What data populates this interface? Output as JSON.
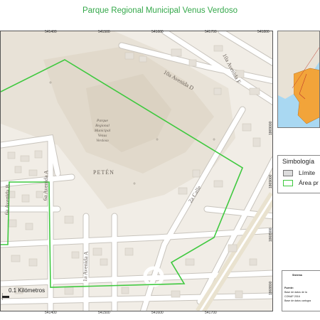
{
  "title": "Parque Regional Municipal Venus Verdoso",
  "map": {
    "labels": {
      "park_name_line1": "Parque",
      "park_name_line2": "Regional",
      "park_name_line3": "Municipal",
      "park_name_line4": "Venus Verdoso",
      "department": "PETÉN"
    },
    "streets": {
      "avenida_f": "10a Avenida F",
      "avenida_d": "10a Avenida D",
      "calle_2a": "2a Calle",
      "avenida_a_top": "6a Avenida A",
      "avenida_a_bottom": "1a Avenida A",
      "avenida_b": "6a Avenida B"
    },
    "ticks_top": [
      "541400",
      "541500",
      "541600",
      "541700",
      "541800"
    ],
    "ticks_bottom": [
      "541400",
      "541500",
      "541600",
      "541700"
    ],
    "ticks_right": [
      "1869000",
      "1869000",
      "1868900",
      "1868800"
    ]
  },
  "legend": {
    "title": "Simbología",
    "items": [
      {
        "label": "Límite",
        "color": "#dcdcdc",
        "border": "#777777"
      },
      {
        "label": "Área pr",
        "color": "#ffffff",
        "border": "#3fc93f"
      }
    ]
  },
  "info_box": {
    "heading": "Sistema",
    "source_label": "Fuente:",
    "source_line1": "Base de datos de la",
    "source_line2": "CONAP 2016",
    "source_line3": "Base de datos cartogra"
  },
  "scale": {
    "label": "0.1 Kilómetros"
  },
  "colors": {
    "park_boundary": "#3fc93f",
    "title": "#34a84a",
    "inset_land": "#f2a43a",
    "inset_sea": "#a9d8f2"
  }
}
